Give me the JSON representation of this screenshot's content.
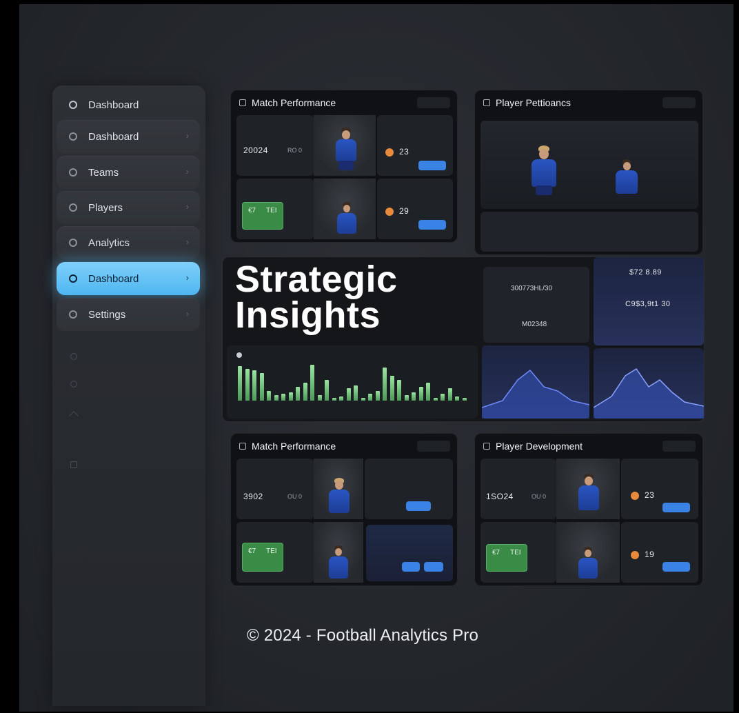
{
  "sidebar": {
    "items": [
      {
        "label": "Dashboard",
        "icon": "shield-icon"
      },
      {
        "label": "Dashboard",
        "icon": "home-icon"
      },
      {
        "label": "Teams",
        "icon": "circle-icon"
      },
      {
        "label": "Players",
        "icon": "circle-icon"
      },
      {
        "label": "Analytics",
        "icon": "circle-icon"
      },
      {
        "label": "Dashboard",
        "icon": "circle-icon",
        "active": true
      },
      {
        "label": "Settings",
        "icon": "gear-icon"
      }
    ]
  },
  "panels": {
    "top_left": {
      "title": "Match Performance",
      "num1": "20024",
      "num2": "RO 0",
      "stat1": "23",
      "stat2": "29",
      "green1": "€7",
      "green2": "TEI"
    },
    "top_right": {
      "title": "Player Pettioancs"
    },
    "bottom_left": {
      "title": "Match Performance",
      "num1": "3902",
      "num2": "OU 0",
      "green1": "€7",
      "green2": "TEI"
    },
    "bottom_right": {
      "title": "Player Development",
      "num1": "1SO24",
      "num2": "OU 0",
      "stat1": "23",
      "stat2": "19",
      "green1": "€7",
      "green2": "TEI"
    }
  },
  "center": {
    "title_line1": "Strategic",
    "title_line2": "Insights",
    "value_a": "$72 8.89",
    "value_b": "C9$3,9t1 30",
    "value_c": "300773HL/30",
    "value_d": "M02348"
  },
  "colors": {
    "accent": "#58bef5",
    "bar_green": "#6bc373",
    "button_blue": "#3b82e6",
    "orange": "#e88a3c"
  },
  "footer": {
    "text": "© 2024 - Football Analytics  Pro"
  }
}
